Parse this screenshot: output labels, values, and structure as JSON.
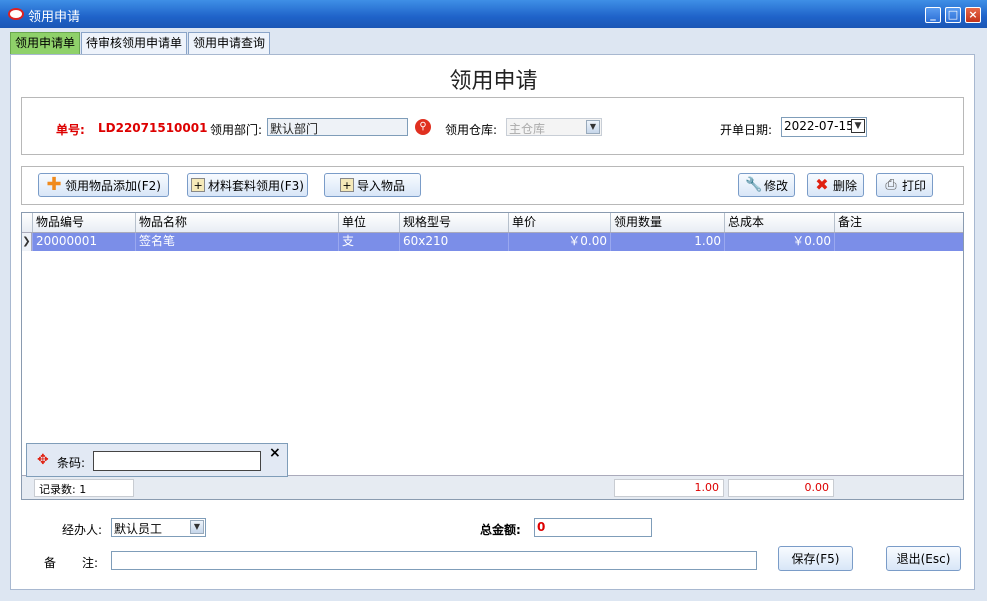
{
  "window": {
    "title": "领用申请",
    "min": "_",
    "max": "□",
    "close": "×"
  },
  "tabs": [
    "领用申请单",
    "待审核领用申请单",
    "领用申请查询"
  ],
  "page_title": "领用申请",
  "header": {
    "doc_no_label": "单号:",
    "doc_no": "LD22071510001",
    "dept_label": "领用部门:",
    "dept_value": "默认部门",
    "warehouse_label": "领用仓库:",
    "warehouse_value": "主仓库",
    "date_label": "开单日期:",
    "date_value": "2022-07-15"
  },
  "toolbar": {
    "add_item": "领用物品添加(F2)",
    "material_set": "材料套料领用(F3)",
    "import": "导入物品",
    "edit": "修改",
    "delete": "删除",
    "print": "打印"
  },
  "table": {
    "columns": [
      "物品编号",
      "物品名称",
      "单位",
      "规格型号",
      "单价",
      "领用数量",
      "总成本",
      "备注"
    ],
    "rows": [
      {
        "code": "20000001",
        "name": "签名笔",
        "unit": "支",
        "spec": "60x210",
        "price": "￥0.00",
        "qty": "1.00",
        "cost": "￥0.00",
        "note": ""
      }
    ],
    "footer": {
      "record_label": "记录数:",
      "record_count": "1",
      "qty_total": "1.00",
      "cost_total": "0.00"
    }
  },
  "barcode": {
    "label": "条码:",
    "value": "",
    "close": "×"
  },
  "bottom": {
    "handler_label": "经办人:",
    "handler_value": "默认员工",
    "total_label": "总金额:",
    "total_value": "0",
    "remark_label_1": "备",
    "remark_label_2": "注:",
    "remark_value": "",
    "save": "保存(F5)",
    "exit": "退出(Esc)"
  }
}
